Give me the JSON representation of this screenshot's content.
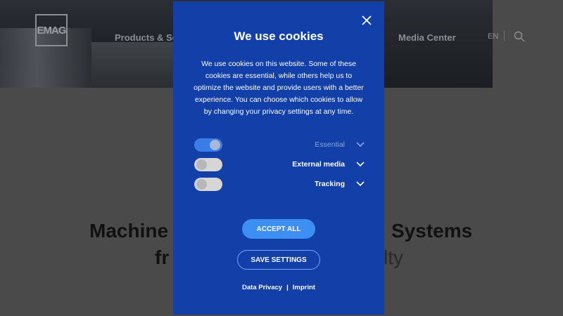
{
  "header": {
    "logo_text": "EMAG",
    "nav": {
      "products": "Products & Serv",
      "media_center": "Media Center"
    },
    "language": "EN"
  },
  "hero": {
    "line1_left": "Machine",
    "line1_right": "Systems",
    "line2_left": "fr",
    "line2_right": "lty"
  },
  "cookie_dialog": {
    "title": "We use cookies",
    "body": "We use cookies on this website. Some of these cookies are essential, while others help us to optimize the website and provide users with a better experience. You can choose which cookies to allow by changing your privacy settings at any time.",
    "options": [
      {
        "label": "Essential",
        "enabled": true,
        "locked": true
      },
      {
        "label": "External media",
        "enabled": false,
        "locked": false
      },
      {
        "label": "Tracking",
        "enabled": false,
        "locked": false
      }
    ],
    "accept_all_label": "ACCEPT ALL",
    "save_settings_label": "SAVE SETTINGS",
    "links": {
      "privacy": "Data Privacy",
      "separator": "|",
      "imprint": "Imprint"
    },
    "colors": {
      "background": "#1240a8",
      "accent": "#3d8ff3"
    }
  }
}
